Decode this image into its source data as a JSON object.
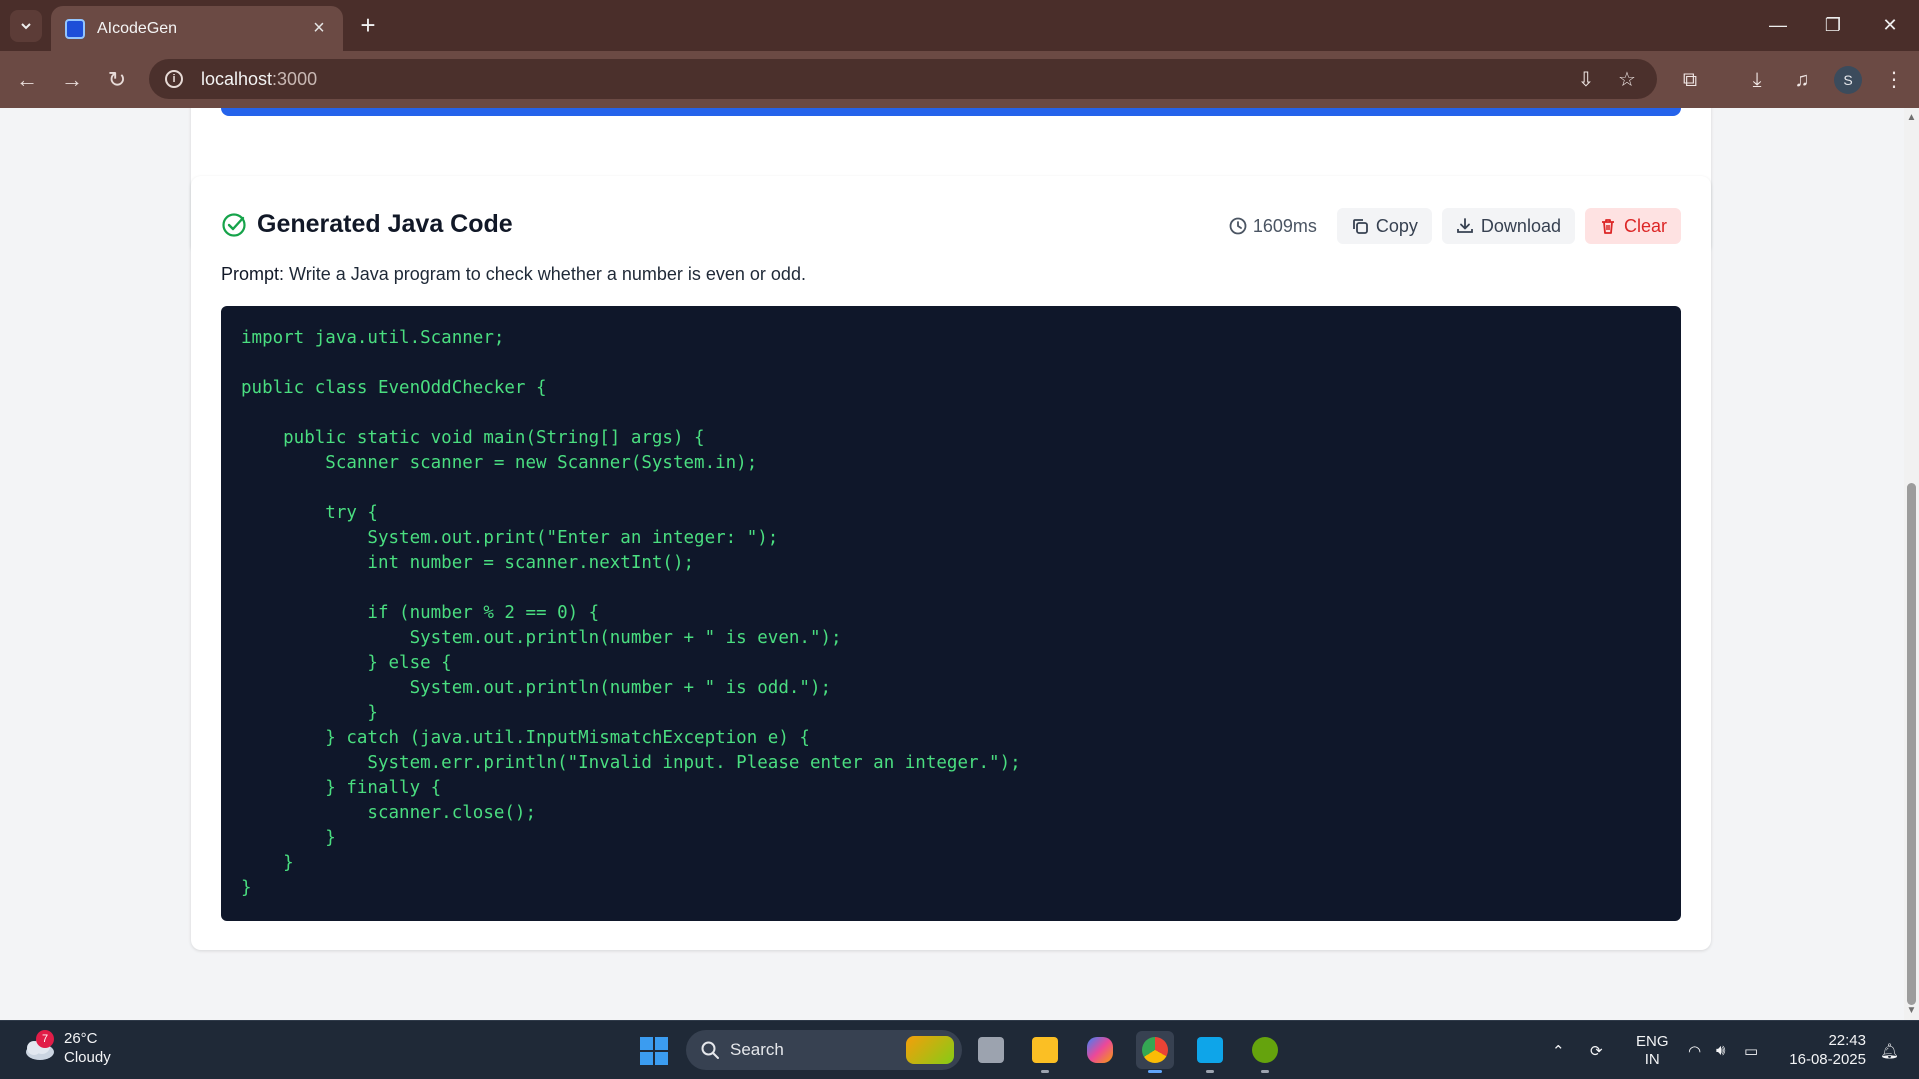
{
  "browser": {
    "tab_title": "AIcodeGen",
    "url_host": "localhost",
    "url_port": ":3000"
  },
  "result": {
    "title": "Generated Java Code",
    "timing": "1609ms",
    "copy_label": "Copy",
    "download_label": "Download",
    "clear_label": "Clear",
    "prompt_label": "Prompt:",
    "prompt_text": " Write a Java program to check whether a number is even or odd.",
    "code": "import java.util.Scanner;\n\npublic class EvenOddChecker {\n\n    public static void main(String[] args) {\n        Scanner scanner = new Scanner(System.in);\n\n        try {\n            System.out.print(\"Enter an integer: \");\n            int number = scanner.nextInt();\n\n            if (number % 2 == 0) {\n                System.out.println(number + \" is even.\");\n            } else {\n                System.out.println(number + \" is odd.\");\n            }\n        } catch (java.util.InputMismatchException e) {\n            System.err.println(\"Invalid input. Please enter an integer.\");\n        } finally {\n            scanner.close();\n        }\n    }\n}"
  },
  "taskbar": {
    "weather_temp": "26°C",
    "weather_desc": "Cloudy",
    "weather_badge": "7",
    "search_label": "Search",
    "lang_top": "ENG",
    "lang_bottom": "IN",
    "time": "22:43",
    "date": "16-08-2025",
    "profile_initial": "S"
  },
  "colors": {
    "accent": "#2563eb",
    "code_bg": "#0f172a",
    "code_text": "#4ade80",
    "danger": "#dc2626",
    "success": "#16a34a"
  }
}
